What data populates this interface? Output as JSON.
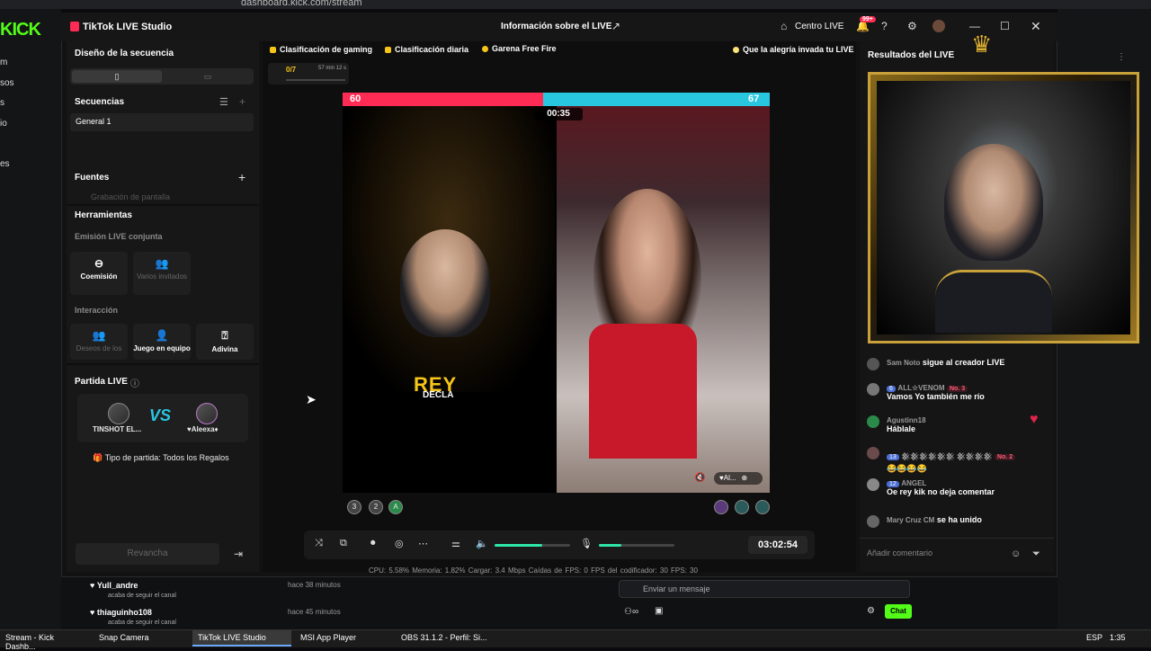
{
  "browser": {
    "url": "dashboard.kick.com/stream"
  },
  "kick": {
    "logo": "KICK",
    "nav": [
      "m",
      "sos",
      "s",
      "io",
      "es"
    ],
    "followers": [
      {
        "name": "Yull_andre",
        "action": "acaba de seguir el canal",
        "time": "hace 38 minutos"
      },
      {
        "name": "thiaguinho108",
        "action": "acaba de seguir el canal",
        "time": "hace 45 minutos"
      }
    ],
    "message_placeholder": "Enviar un mensaje",
    "chat_button": "Chat"
  },
  "window": {
    "title": "TikTok LIVE Studio",
    "center_title": "Información sobre el LIVE",
    "centro_live": "Centro LIVE",
    "notifications": "99+"
  },
  "left": {
    "scene_design": "Diseño de la secuencia",
    "sequences": "Secuencias",
    "sequence_item": "General 1",
    "sources": "Fuentes",
    "source_item": "Grabación de pantalla",
    "tools": "Herramientas",
    "co_live": "Emisión LIVE conjunta",
    "coemission": "Coemisión",
    "multi_guests": "Varios invitados",
    "interaction": "Interacción",
    "wishes": "Deseos de los",
    "team_game": "Juego en equipo",
    "guess": "Adivina",
    "match_title": "Partida LIVE",
    "player1": "TINSHOT EL...",
    "vs": "VS",
    "player2": "♥Aleexa♦",
    "match_type": "Tipo de partida: Todos los Regalos",
    "rematch": "Revancha"
  },
  "center": {
    "chips": [
      "Clasificación de gaming",
      "Clasificación diaria",
      "Garena Free Fire"
    ],
    "motto": "Que la alegría invada tu LIVE",
    "progress_count": "0/7",
    "progress_time": "57 min 12 s",
    "score_left": "60",
    "score_right": "67",
    "match_timer": "00:35",
    "rey": "REY",
    "decla": "DECLA",
    "guest_label": "♥Al...",
    "left_supporters": [
      "3",
      "2",
      "A"
    ],
    "stream_time": "03:02:54",
    "stats": "CPU: 5.58%    Memoria: 1.82%    Cargar: 3.4 Mbps    Caídas de FPS: 0    FPS del codificador: 30    FPS: 30"
  },
  "levels": {
    "speaker": 0.63,
    "mic": 0.3
  },
  "right": {
    "title": "Resultados del LIVE",
    "chat": [
      {
        "user": "Sam Noto",
        "msg": "sigue al creador LIVE",
        "badges": []
      },
      {
        "user": "ALL☆VENOM",
        "msg": "Vamos Yo también me río",
        "badges": [
          "6",
          "No. 3"
        ]
      },
      {
        "user": "Agustinn18",
        "msg": "Háblale",
        "badges": []
      },
      {
        "user": "𒆜𒆜𒆜𒆜𒆜𒆜 𒆜𒆜𒆜𒆜",
        "msg": "😂😂😂😂",
        "badges": [
          "13",
          "No. 2"
        ]
      },
      {
        "user": "ANGEL",
        "msg": "Oe rey kik no deja comentar",
        "badges": [
          "12"
        ]
      },
      {
        "user": "Mary Cruz CM",
        "msg": "se ha unido",
        "badges": []
      }
    ],
    "comment_placeholder": "Añadir comentario"
  },
  "taskbar": {
    "tasks": [
      "Stream - Kick Dashb...",
      "Snap Camera",
      "TikTok LIVE Studio",
      "MSI App Player",
      "OBS 31.1.2 - Perfil: Si..."
    ],
    "lang": "ESP",
    "clock": "1:35"
  },
  "colors": {
    "tiktok_pink": "#fe2c55",
    "tiktok_cyan": "#29c6e0",
    "kick_green": "#53fc18"
  }
}
